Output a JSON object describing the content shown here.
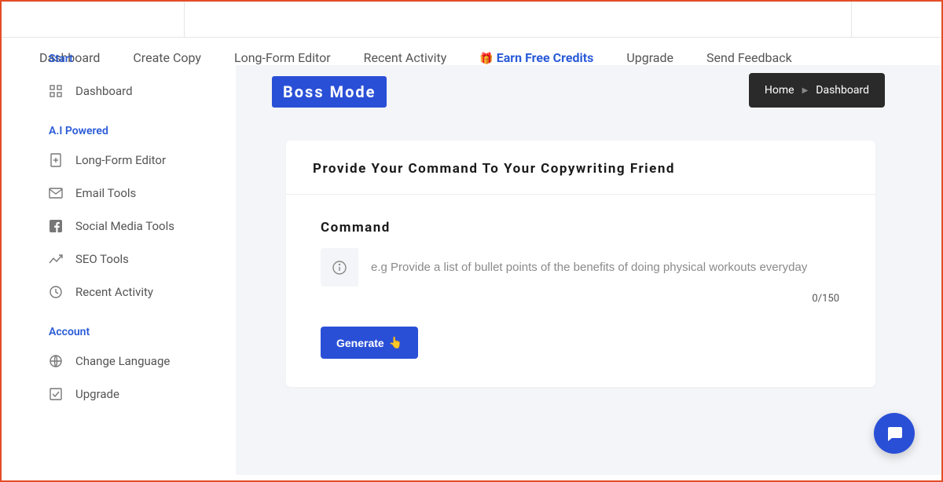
{
  "topnav": {
    "items": [
      {
        "label": "Dashboard"
      },
      {
        "label": "Create Copy"
      },
      {
        "label": "Long-Form Editor"
      },
      {
        "label": "Recent Activity"
      },
      {
        "label": "Earn Free Credits",
        "highlight": true,
        "icon": "🎁"
      },
      {
        "label": "Upgrade"
      },
      {
        "label": "Send Feedback"
      }
    ]
  },
  "sidebar": {
    "start_label": "Start",
    "dashboard": "Dashboard",
    "section_ai": "A.I Powered",
    "longform": "Long-Form Editor",
    "email": "Email Tools",
    "social": "Social Media Tools",
    "seo": "SEO Tools",
    "recent": "Recent Activity",
    "section_account": "Account",
    "language": "Change Language",
    "upgrade": "Upgrade"
  },
  "content": {
    "boss_mode": "Boss Mode",
    "breadcrumb_home": "Home",
    "breadcrumb_current": "Dashboard",
    "card_title": "Provide Your Command To Your Copywriting Friend",
    "command_label": "Command",
    "command_placeholder": "e.g Provide a list of bullet points of the benefits of doing physical workouts everyday",
    "counter": "0/150",
    "generate_label": "Generate",
    "generate_emoji": "👆"
  }
}
